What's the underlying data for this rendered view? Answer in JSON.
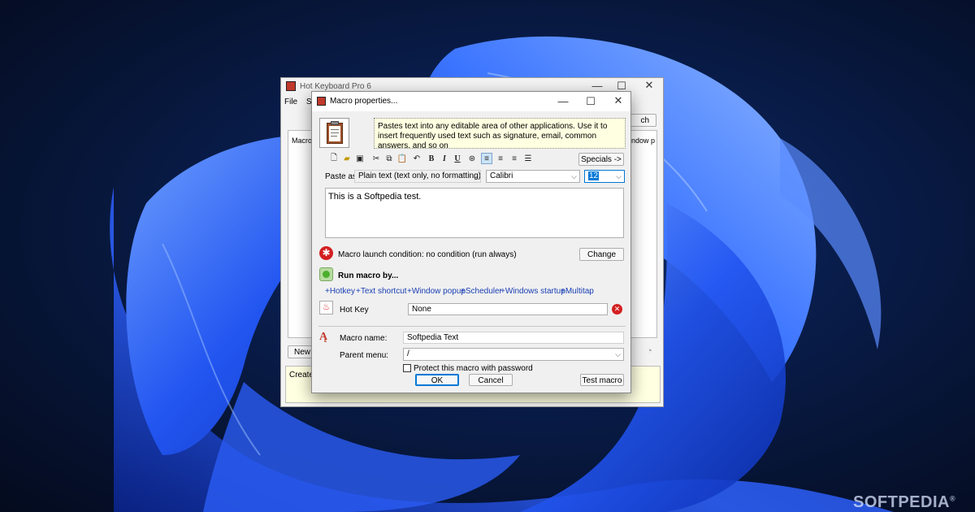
{
  "desktop": {
    "watermark": "SOFTPEDIA",
    "watermark_mark": "®"
  },
  "main_window": {
    "title": "Hot Keyboard Pro 6",
    "menu": [
      "File",
      "Se"
    ],
    "search_button": "ch",
    "list_header_left": "Macro",
    "list_header_right": "Window p",
    "new_button": "New",
    "bottom_text": "Create"
  },
  "dialog": {
    "title": "Macro properties...",
    "description": "Pastes text into any editable area of other applications. Use it to insert frequently used text such as signature, email, common answers, and so on",
    "toolbar": {
      "bold": "B",
      "italic": "I",
      "underline": "U",
      "specials_button": "Specials ->"
    },
    "paste_as": {
      "label": "Paste as:",
      "value": "Plain text (text only, no formatting)"
    },
    "font": "Calibri",
    "font_size": "12",
    "text_content": "This is a Softpedia test.",
    "launch_condition": "Macro launch condition: no condition (run always)",
    "change_button": "Change",
    "run_by_title": "Run macro by...",
    "run_options": [
      "+Hotkey",
      "+Text shortcut",
      "+Window popup",
      "+Scheduler",
      "+Windows startup",
      "+Multitap"
    ],
    "hotkey": {
      "label": "Hot Key",
      "value": "None"
    },
    "macro_name": {
      "label": "Macro name:",
      "value": "Softpedia Text"
    },
    "parent_menu": {
      "label": "Parent menu:",
      "value": "/"
    },
    "protect_label": "Protect this macro with password",
    "protect_checked": false,
    "ok_button": "OK",
    "cancel_button": "Cancel",
    "test_button": "Test macro"
  },
  "colors": {
    "desktop_dark": "#06102a",
    "flower_blue": "#1f4fe0",
    "dialog_bg": "#f0f0f0",
    "note_bg": "#ffffe1",
    "link": "#1a3fb3",
    "accent": "#0078d7",
    "delete_red": "#d32020"
  }
}
